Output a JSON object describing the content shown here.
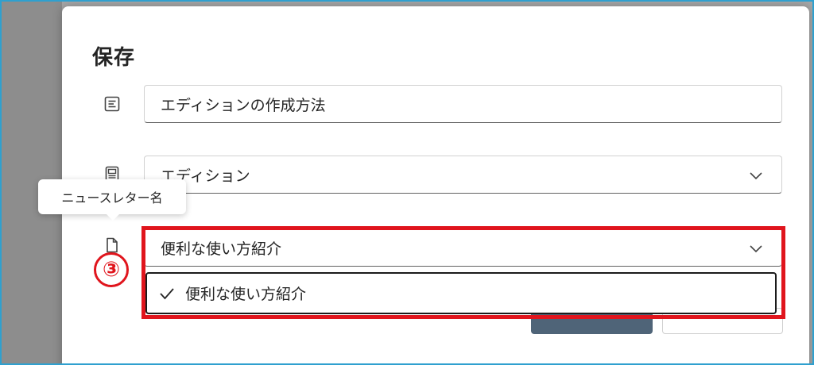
{
  "dialog": {
    "title": "保存",
    "title_field_value": "エディションの作成方法",
    "newsletter_select_value": "エディション",
    "tooltip_text": "ニュースレター名",
    "category_select_value": "便利な使い方紹介",
    "dropdown_option_selected": "便利な使い方紹介"
  },
  "annotation": {
    "step_label": "③",
    "highlight_color": "#e0151d"
  },
  "icons": {
    "title_row": "text-lines-icon",
    "newsletter_row": "newsletter-icon",
    "category_row": "document-icon",
    "select_chevron": "chevron-down-icon",
    "selected_check": "checkmark-icon"
  },
  "colors": {
    "backdrop": "#a7a7a7",
    "primary_button": "#4f6478",
    "frame_border": "#2fa0cf"
  }
}
